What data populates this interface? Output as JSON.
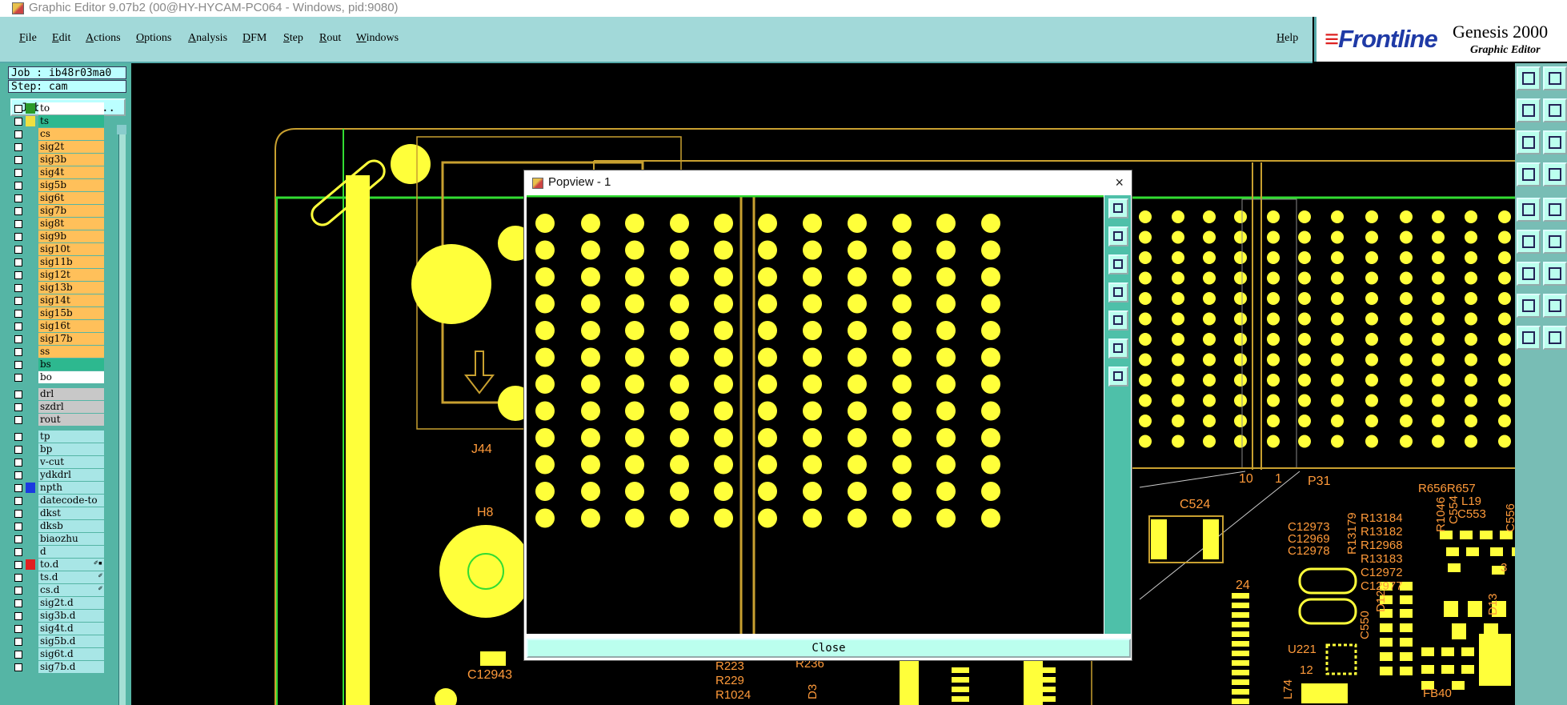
{
  "window": {
    "title": "Graphic Editor 9.07b2 (00@HY-HYCAM-PC064 - Windows, pid:9080)"
  },
  "menu": {
    "items": [
      "File",
      "Edit",
      "Actions",
      "Options",
      "Analysis",
      "DFM",
      "Step",
      "Rout",
      "Windows"
    ],
    "help": "Help"
  },
  "brand": {
    "logo": "Frontline",
    "product": "Genesis 2000",
    "subtitle": "Graphic Editor"
  },
  "job": {
    "job_label": "Job : ib48r03ma0",
    "step_label": "Step: cam",
    "matrix_button": "Job Matrix ..."
  },
  "layers": [
    {
      "name": "to",
      "color": "#ffffff",
      "swatch": "#2a9a2a"
    },
    {
      "name": "ts",
      "color": "#2db88f",
      "swatch": "#f0e040"
    },
    {
      "name": "cs",
      "color": "#ffc05a"
    },
    {
      "name": "sig2t",
      "color": "#ffc05a"
    },
    {
      "name": "sig3b",
      "color": "#ffc05a"
    },
    {
      "name": "sig4t",
      "color": "#ffc05a"
    },
    {
      "name": "sig5b",
      "color": "#ffc05a"
    },
    {
      "name": "sig6t",
      "color": "#ffc05a"
    },
    {
      "name": "sig7b",
      "color": "#ffc05a"
    },
    {
      "name": "sig8t",
      "color": "#ffc05a"
    },
    {
      "name": "sig9b",
      "color": "#ffc05a"
    },
    {
      "name": "sig10t",
      "color": "#ffc05a"
    },
    {
      "name": "sig11b",
      "color": "#ffc05a"
    },
    {
      "name": "sig12t",
      "color": "#ffc05a"
    },
    {
      "name": "sig13b",
      "color": "#ffc05a"
    },
    {
      "name": "sig14t",
      "color": "#ffc05a"
    },
    {
      "name": "sig15b",
      "color": "#ffc05a"
    },
    {
      "name": "sig16t",
      "color": "#ffc05a"
    },
    {
      "name": "sig17b",
      "color": "#ffc05a"
    },
    {
      "name": "ss",
      "color": "#ffc05a"
    },
    {
      "name": "bs",
      "color": "#2db88f"
    },
    {
      "name": "bo",
      "color": "#ffffff"
    },
    {
      "name": "drl",
      "color": "#c8c8c8",
      "gap": true
    },
    {
      "name": "szdrl",
      "color": "#c8c8c8"
    },
    {
      "name": "rout",
      "color": "#c8c8c8"
    },
    {
      "name": "tp",
      "color": "#a8e6e6",
      "gap": true
    },
    {
      "name": "bp",
      "color": "#a8e6e6"
    },
    {
      "name": "v-cut",
      "color": "#a8e6e6"
    },
    {
      "name": "ydkdrl",
      "color": "#a8e6e6"
    },
    {
      "name": "npth",
      "color": "#a8e6e6",
      "swatch": "#1a3ae0"
    },
    {
      "name": "datecode-to",
      "color": "#a8e6e6"
    },
    {
      "name": "dkst",
      "color": "#a8e6e6"
    },
    {
      "name": "dksb",
      "color": "#a8e6e6"
    },
    {
      "name": "biaozhu",
      "color": "#a8e6e6"
    },
    {
      "name": "d",
      "color": "#a8e6e6"
    },
    {
      "name": "to.d",
      "color": "#a8e6e6",
      "swatch": "#e02020",
      "mark": "✐▪"
    },
    {
      "name": "ts.d",
      "color": "#a8e6e6",
      "mark": "✐"
    },
    {
      "name": "cs.d",
      "color": "#a8e6e6",
      "mark": "✐"
    },
    {
      "name": "sig2t.d",
      "color": "#a8e6e6"
    },
    {
      "name": "sig3b.d",
      "color": "#a8e6e6"
    },
    {
      "name": "sig4t.d",
      "color": "#a8e6e6"
    },
    {
      "name": "sig5b.d",
      "color": "#a8e6e6"
    },
    {
      "name": "sig6t.d",
      "color": "#a8e6e6"
    },
    {
      "name": "sig7b.d",
      "color": "#a8e6e6"
    }
  ],
  "canvas": {
    "labels": [
      "J44",
      "H8",
      "C12943",
      "C524",
      "10",
      "1",
      "P31",
      "24",
      "U221",
      "12",
      "R656R657",
      "L19",
      "C553",
      "C554",
      "R1046",
      "C556",
      "C12973",
      "C12969",
      "C12978",
      "R13184",
      "R13182",
      "R13183",
      "R12968",
      "C12972",
      "C12977",
      "R13179",
      "C550",
      "D12",
      "D13",
      "L74",
      "FB40",
      "R223",
      "R229",
      "R1024",
      "R236",
      "D3",
      "3"
    ]
  },
  "popup": {
    "title": "Popview - 1",
    "close": "Close",
    "close_icon": "×"
  },
  "colors": {
    "pad": "#ffff3a",
    "outline": "#c8a030",
    "trace": "#32dc32",
    "panel": "#a2d9d9"
  }
}
